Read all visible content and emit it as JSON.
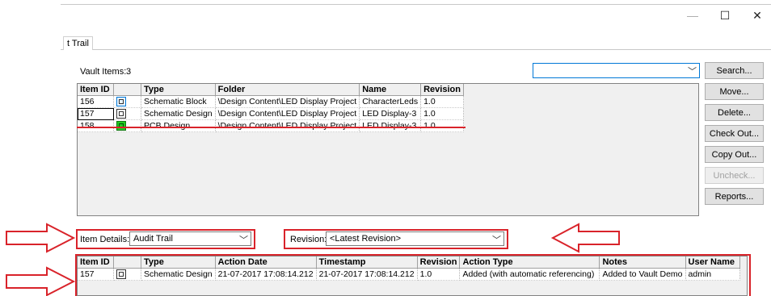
{
  "window": {
    "minimize_glyph": "—",
    "maximize_glyph": "☐",
    "close_glyph": "✕"
  },
  "tab": {
    "label": "t Trail"
  },
  "vault": {
    "items_label": "Vault Items:",
    "items_count": "3",
    "search_combo_value": ""
  },
  "buttons": {
    "search": "Search...",
    "move": "Move...",
    "delete": "Delete...",
    "check_out": "Check Out...",
    "copy_out": "Copy Out...",
    "uncheck": "Uncheck...",
    "reports": "Reports..."
  },
  "items_table": {
    "columns": [
      "Item ID",
      "",
      "Type",
      "Folder",
      "Name",
      "Revision"
    ],
    "rows": [
      {
        "id": "156",
        "icon": "schematic-block-icon",
        "type": "Schematic Block",
        "folder": "\\Design Content\\LED Display Project",
        "name": "CharacterLeds",
        "revision": "1.0"
      },
      {
        "id": "157",
        "icon": "schematic-design-icon",
        "type": "Schematic Design",
        "folder": "\\Design Content\\LED Display Project",
        "name": "LED Display-3",
        "revision": "1.0"
      },
      {
        "id": "158",
        "icon": "pcb-design-icon",
        "type": "PCB Design",
        "folder": "\\Design Content\\LED Display Project",
        "name": "LED Display-3",
        "revision": "1.0"
      }
    ]
  },
  "details": {
    "item_details_label": "Item Details:",
    "item_details_value": "Audit Trail",
    "revision_label": "Revision:",
    "revision_value": "<Latest Revision>"
  },
  "audit_table": {
    "columns": [
      "Item ID",
      "",
      "Type",
      "Action Date",
      "Timestamp",
      "Revision",
      "Action Type",
      "Notes",
      "User Name"
    ],
    "rows": [
      {
        "id": "157",
        "icon": "schematic-design-icon",
        "type": "Schematic Design",
        "action_date": "21-07-2017 17:08:14.212",
        "timestamp": "21-07-2017 17:08:14.212",
        "revision": "1.0",
        "action_type": "Added (with automatic referencing)",
        "notes": "Added to Vault Demo",
        "user": "admin"
      }
    ]
  },
  "colors": {
    "highlight": "#d9232a",
    "button_face": "#e1e1e1",
    "header_bg": "#f0f0f0"
  }
}
